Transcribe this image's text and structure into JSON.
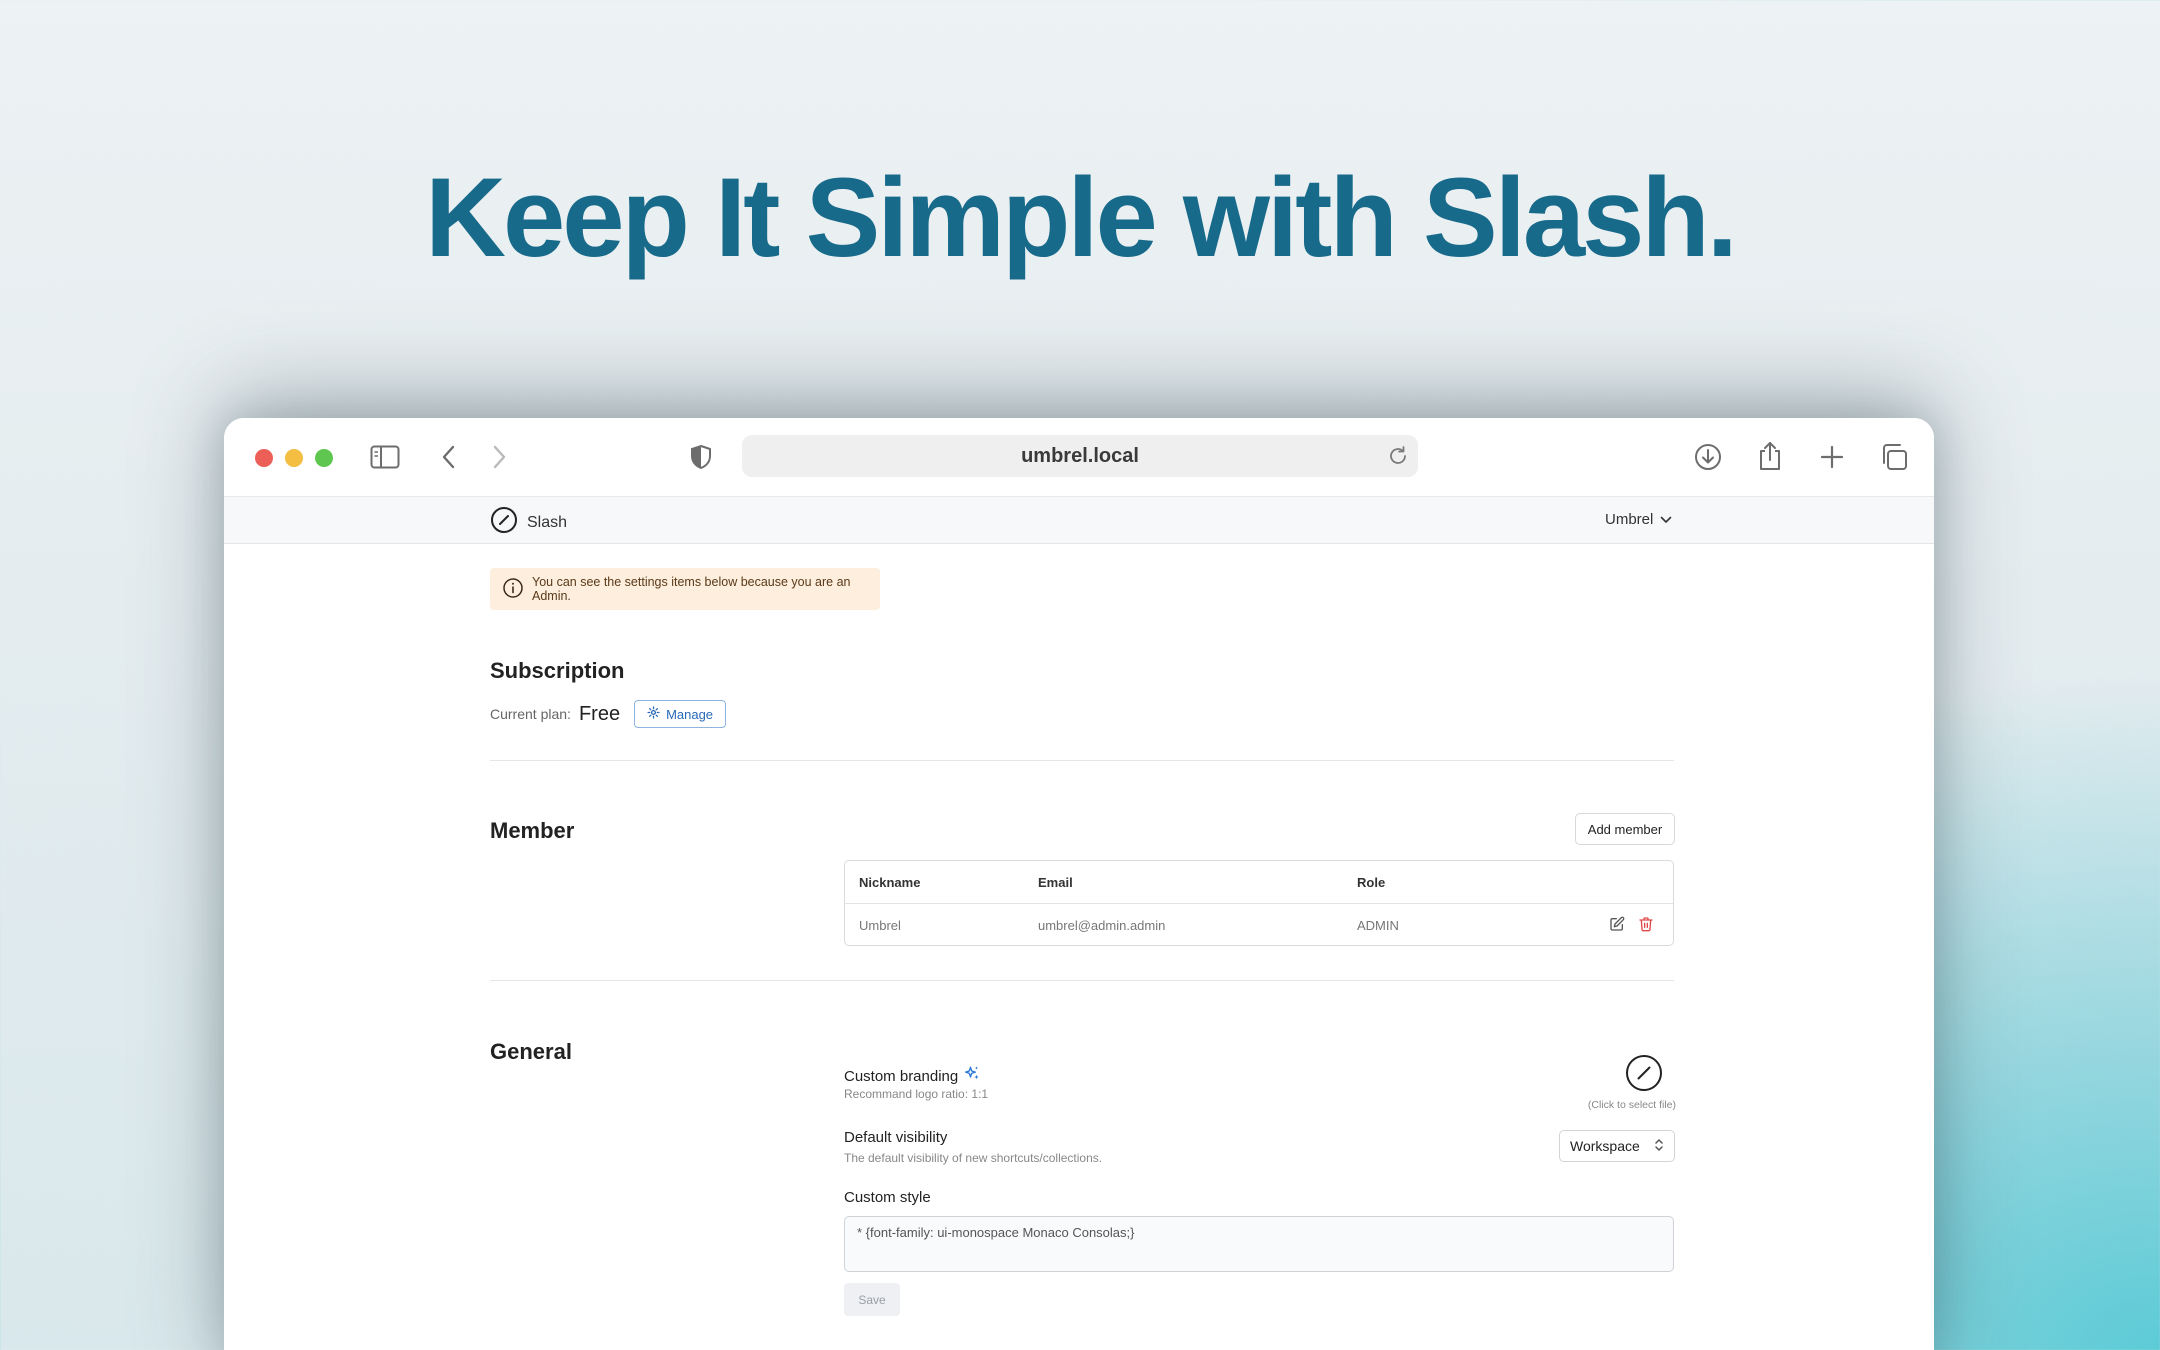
{
  "hero": {
    "title": "Keep It Simple with Slash."
  },
  "browser": {
    "url": "umbrel.local",
    "icons": [
      "sidebar-toggle-icon",
      "back-chevron-icon",
      "forward-chevron-icon",
      "shield-icon",
      "reload-icon",
      "download-icon",
      "share-icon",
      "plus-icon",
      "tabs-icon"
    ]
  },
  "app": {
    "brand_name": "Slash",
    "workspace_name": "Umbrel"
  },
  "alert": {
    "text": "You can see the settings items below because you are an Admin."
  },
  "subscription": {
    "title": "Subscription",
    "current_plan_label": "Current plan:",
    "plan_value": "Free",
    "manage_label": "Manage"
  },
  "member": {
    "title": "Member",
    "add_button": "Add member",
    "columns": [
      "Nickname",
      "Email",
      "Role"
    ],
    "rows": [
      {
        "nickname": "Umbrel",
        "email": "umbrel@admin.admin",
        "role": "ADMIN"
      }
    ]
  },
  "general": {
    "title": "General",
    "custom_branding_label": "Custom branding",
    "custom_branding_desc": "Recommand logo ratio: 1:1",
    "logo_hint": "(Click to select file)",
    "default_visibility_label": "Default visibility",
    "default_visibility_desc": "The default visibility of new shortcuts/collections.",
    "default_visibility_value": "Workspace",
    "custom_style_label": "Custom style",
    "custom_style_value": "* {font-family: ui-monospace Monaco Consolas;}",
    "save_label": "Save"
  },
  "colors": {
    "hero": "#186a8b",
    "accent_blue": "#2869b8",
    "alert_bg": "#fdeedd",
    "danger": "#e04848"
  }
}
